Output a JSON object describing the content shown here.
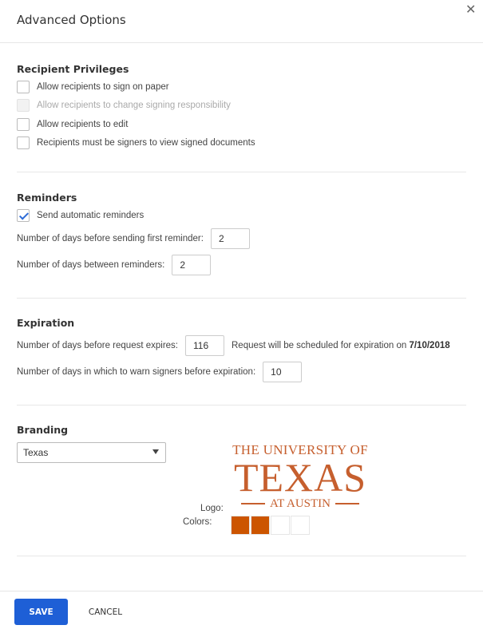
{
  "dialog": {
    "title": "Advanced Options",
    "close_icon": "close-icon"
  },
  "recipient_privileges": {
    "title": "Recipient Privileges",
    "options": [
      {
        "label": "Allow recipients to sign on paper",
        "checked": false,
        "disabled": false
      },
      {
        "label": "Allow recipients to change signing responsibility",
        "checked": false,
        "disabled": true
      },
      {
        "label": "Allow recipients to edit",
        "checked": false,
        "disabled": false
      },
      {
        "label": "Recipients must be signers to view signed documents",
        "checked": false,
        "disabled": false
      }
    ]
  },
  "reminders": {
    "title": "Reminders",
    "auto_label": "Send automatic reminders",
    "auto_checked": true,
    "first_label": "Number of days before sending first reminder:",
    "first_value": "2",
    "between_label": "Number of days between reminders:",
    "between_value": "2"
  },
  "expiration": {
    "title": "Expiration",
    "expires_label": "Number of days before request expires:",
    "expires_value": "116",
    "note_prefix": "Request will be scheduled for expiration on ",
    "note_date": "7/10/2018",
    "warn_label": "Number of days in which to warn signers before expiration:",
    "warn_value": "10"
  },
  "branding": {
    "title": "Branding",
    "selected": "Texas",
    "logo_label": "Logo:",
    "logo_text": {
      "line1": "THE UNIVERSITY OF",
      "line2": "TEXAS",
      "line3": "AT AUSTIN"
    },
    "colors_label": "Colors:",
    "colors": [
      "#cc5500",
      "#cc5500",
      "#ffffff",
      "#ffffff"
    ]
  },
  "footer": {
    "save_label": "SAVE",
    "cancel_label": "CANCEL"
  }
}
